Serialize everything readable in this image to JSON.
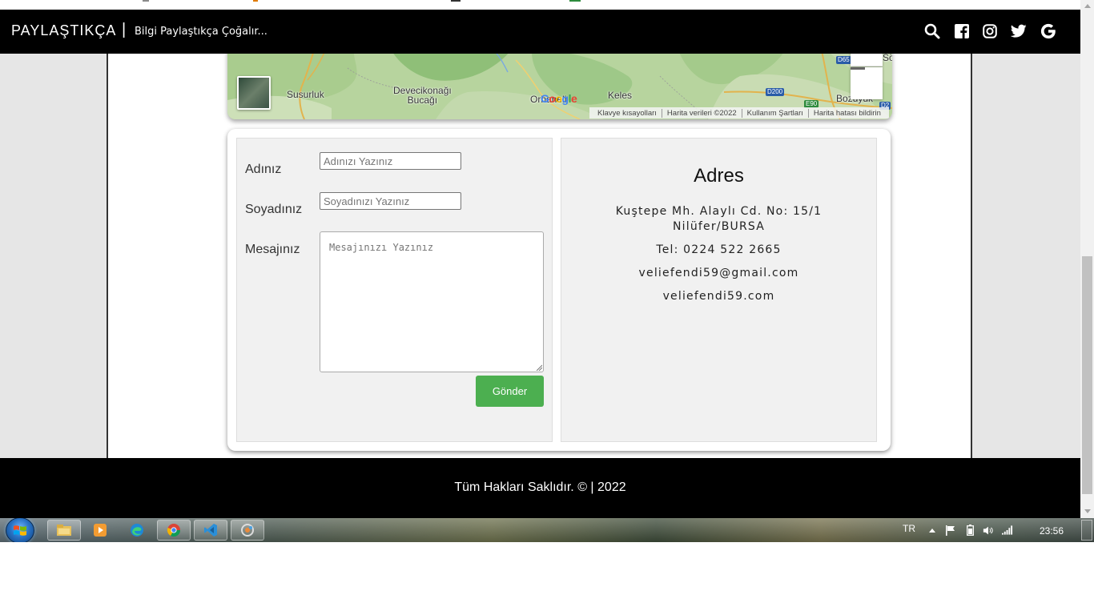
{
  "brand": {
    "name": "PAYLAŞTIKÇA",
    "separator": "|",
    "tagline": "Bilgi Paylaştıkça Çoğalır..."
  },
  "nav_icons": [
    "search-icon",
    "facebook-icon",
    "instagram-icon",
    "twitter-icon",
    "google-icon"
  ],
  "map": {
    "labels": {
      "susurluk": "Susurluk",
      "devecikonagi": "Devecikonağı\nBucağı",
      "orhaneli": "Orhaneli",
      "keles": "Keles",
      "bozuyuk": "Bozüyük",
      "se": "Sö"
    },
    "road_shields": {
      "d65": "D65",
      "d200": "D200",
      "e90": "E90",
      "d2": "D2"
    },
    "google_logo": "Google",
    "attribution": {
      "shortcuts": "Klavye kısayolları",
      "map_data": "Harita verileri ©2022",
      "terms": "Kullanım Şartları",
      "report": "Harita hatası bildirin"
    },
    "zoom_in": "+",
    "zoom_out": "—"
  },
  "form": {
    "name_label": "Adınız",
    "name_placeholder": "Adınızı Yazınız",
    "surname_label": "Soyadınız",
    "surname_placeholder": "Soyadınızı Yazınız",
    "message_label": "Mesajınız",
    "message_placeholder": "Mesajınızı Yazınız",
    "submit_label": "Gönder"
  },
  "address": {
    "title": "Adres",
    "line1": "Kuştepe Mh. Alaylı Cd. No: 15/1",
    "line2": "Nilüfer/BURSA",
    "phone": "Tel: 0224 522 2665",
    "email": "veliefendi59@gmail.com",
    "website": "veliefendi59.com"
  },
  "footer": {
    "text": "Tüm Hakları Saklıdır. © | 2022"
  },
  "taskbar": {
    "apps": [
      "windows-explorer",
      "media-player",
      "edge",
      "chrome",
      "vscode",
      "control-panel"
    ],
    "language": "TR",
    "clock": "23:56"
  },
  "colors": {
    "nav_bg": "#000000",
    "submit_bg": "#4caf50",
    "panel_bg": "#f1f1f1",
    "page_bg": "#e6e6e6"
  }
}
